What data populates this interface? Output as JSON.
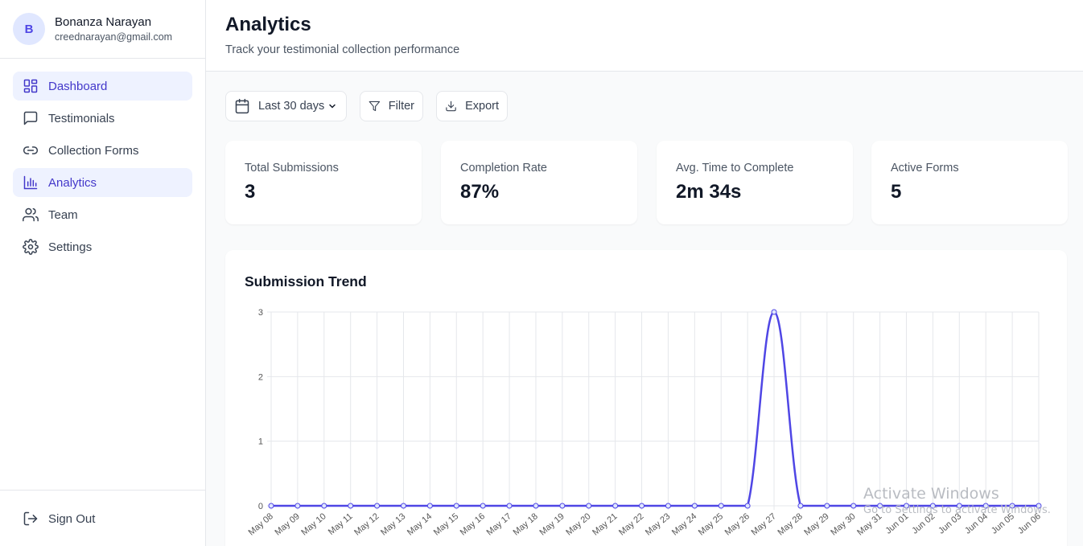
{
  "user": {
    "initial": "B",
    "name": "Bonanza Narayan",
    "email": "creednarayan@gmail.com"
  },
  "sidebar": {
    "items": [
      {
        "label": "Dashboard",
        "icon": "dashboard-icon"
      },
      {
        "label": "Testimonials",
        "icon": "message-icon"
      },
      {
        "label": "Collection Forms",
        "icon": "link-icon"
      },
      {
        "label": "Analytics",
        "icon": "bar-chart-icon"
      },
      {
        "label": "Team",
        "icon": "users-icon"
      },
      {
        "label": "Settings",
        "icon": "gear-icon"
      }
    ],
    "active": "Analytics",
    "sign_out": "Sign Out"
  },
  "header": {
    "title": "Analytics",
    "subtitle": "Track your testimonial collection performance"
  },
  "toolbar": {
    "date_range": "Last 30 days",
    "filter_label": "Filter",
    "export_label": "Export"
  },
  "stats": [
    {
      "label": "Total Submissions",
      "value": "3"
    },
    {
      "label": "Completion Rate",
      "value": "87%"
    },
    {
      "label": "Avg. Time to Complete",
      "value": "2m 34s"
    },
    {
      "label": "Active Forms",
      "value": "5"
    }
  ],
  "chart_data": {
    "type": "line",
    "title": "Submission Trend",
    "categories": [
      "May 08",
      "May 09",
      "May 10",
      "May 11",
      "May 12",
      "May 13",
      "May 14",
      "May 15",
      "May 16",
      "May 17",
      "May 18",
      "May 19",
      "May 20",
      "May 21",
      "May 22",
      "May 23",
      "May 24",
      "May 25",
      "May 26",
      "May 27",
      "May 28",
      "May 29",
      "May 30",
      "May 31",
      "Jun 01",
      "Jun 02",
      "Jun 03",
      "Jun 04",
      "Jun 05",
      "Jun 06"
    ],
    "series": [
      {
        "values": [
          0,
          0,
          0,
          0,
          0,
          0,
          0,
          0,
          0,
          0,
          0,
          0,
          0,
          0,
          0,
          0,
          0,
          0,
          0,
          3,
          0,
          0,
          0,
          0,
          0,
          0,
          0,
          0,
          0,
          0
        ]
      }
    ],
    "yticks": [
      0,
      1,
      2,
      3
    ],
    "ylim": [
      0,
      3
    ],
    "grid": true,
    "color": "#4f46e5"
  },
  "watermark": {
    "title": "Activate Windows",
    "subtitle": "Go to Settings to activate Windows."
  }
}
